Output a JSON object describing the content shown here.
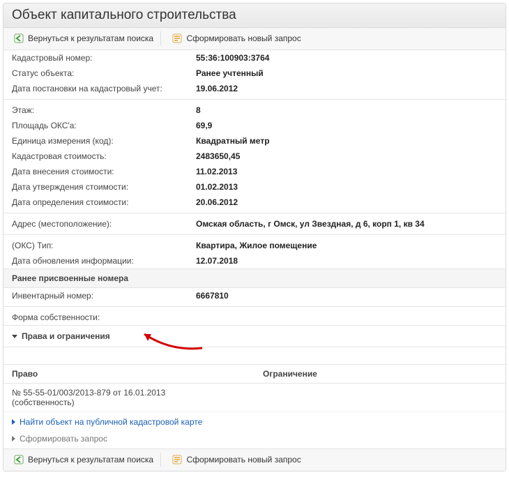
{
  "title": "Объект капитального строительства",
  "toolbar": {
    "back": "Вернуться к результатам поиска",
    "newreq": "Сформировать новый запрос"
  },
  "fields_main": [
    {
      "label": "Кадастровый номер:",
      "value": "55:36:100903:3764"
    },
    {
      "label": "Статус объекта:",
      "value": "Ранее учтенный"
    },
    {
      "label": "Дата постановки на кадастровый учет:",
      "value": "19.06.2012"
    }
  ],
  "fields_block2": [
    {
      "label": "Этаж:",
      "value": "8"
    },
    {
      "label": "Площадь ОКС'а:",
      "value": "69,9"
    },
    {
      "label": "Единица измерения (код):",
      "value": "Квадратный метр"
    },
    {
      "label": "Кадастровая стоимость:",
      "value": "2483650,45"
    },
    {
      "label": "Дата внесения стоимости:",
      "value": "11.02.2013"
    },
    {
      "label": "Дата утверждения стоимости:",
      "value": "01.02.2013"
    },
    {
      "label": "Дата определения стоимости:",
      "value": "20.06.2012"
    }
  ],
  "fields_block3": [
    {
      "label": "Адрес (местоположение):",
      "value": "Омская область, г Омск, ул Звездная, д 6, корп 1, кв 34"
    }
  ],
  "fields_block4": [
    {
      "label": "(ОКС) Тип:",
      "value": "Квартира, Жилое помещение"
    },
    {
      "label": "Дата обновления информации:",
      "value": "12.07.2018"
    }
  ],
  "section_prev_numbers": "Ранее присвоенные номера",
  "fields_prev_numbers": [
    {
      "label": "Инвентарный номер:",
      "value": "6667810"
    }
  ],
  "fields_ownership": [
    {
      "label": "Форма собственности:",
      "value": ""
    }
  ],
  "accordion_rights": "Права и ограничения",
  "rights_cols": {
    "right": "Право",
    "limit": "Ограничение"
  },
  "right_entry": {
    "num": "№ 55-55-01/003/2013-879  от 16.01.2013",
    "type": "(собственность)"
  },
  "links": {
    "find_on_map": "Найти объект на публичной кадастровой карте",
    "make_request": "Сформировать запрос"
  }
}
